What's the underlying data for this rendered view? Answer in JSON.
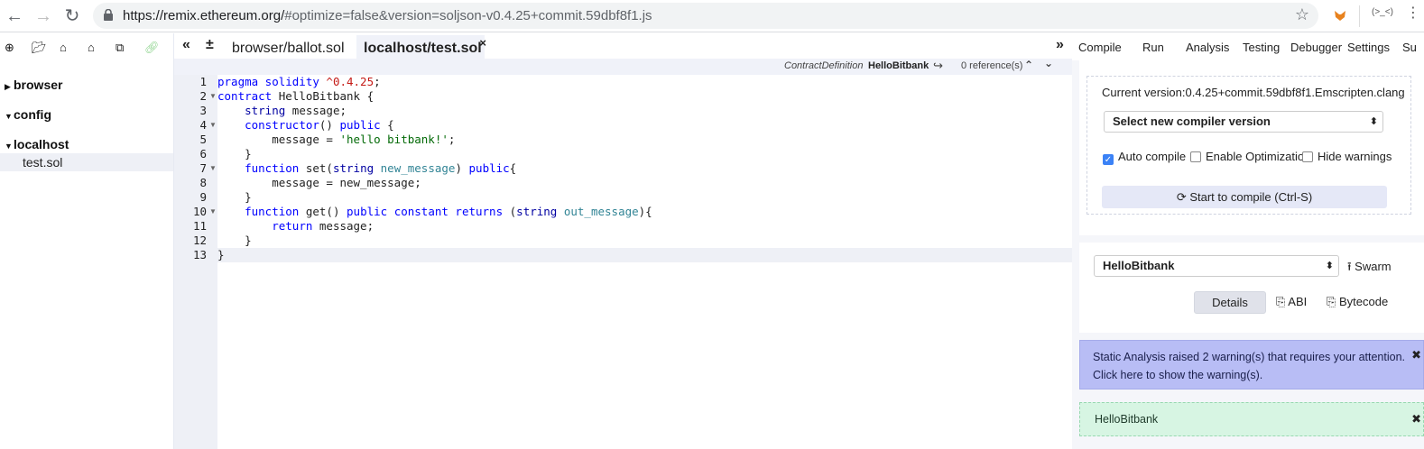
{
  "browser": {
    "url_host": "https://remix.ethereum.org/",
    "url_rest": "#optimize=false&version=soljson-v0.4.25+commit.59dbf8f1.js",
    "extension_text": "(>_<)"
  },
  "file_panel": {
    "tree": [
      {
        "label": "browser",
        "expanded": false
      },
      {
        "label": "config",
        "expanded": true
      },
      {
        "label": "localhost",
        "expanded": true
      }
    ],
    "file": "test.sol"
  },
  "editor": {
    "tabs": [
      {
        "label": "browser/ballot.sol",
        "active": false
      },
      {
        "label": "localhost/test.sol",
        "active": true
      }
    ],
    "close_glyph": "×",
    "info": {
      "definition": "ContractDefinition",
      "name": "HelloBitbank",
      "references": "0 reference(s)"
    },
    "line_numbers": [
      "1",
      "2",
      "3",
      "4",
      "5",
      "6",
      "7",
      "8",
      "9",
      "10",
      "11",
      "12",
      "13"
    ]
  },
  "right_panel": {
    "tabs": [
      "Compile",
      "Run",
      "Analysis",
      "Testing",
      "Debugger",
      "Settings",
      "Su"
    ],
    "current_version": "Current version:0.4.25+commit.59dbf8f1.Emscripten.clang",
    "compiler_select": "Select new compiler version",
    "checkboxes": [
      {
        "label": "Auto compile",
        "checked": true
      },
      {
        "label": "Enable Optimization",
        "checked": false
      },
      {
        "label": "Hide warnings",
        "checked": false
      }
    ],
    "compile_button": "Start to compile (Ctrl-S)",
    "contract_select": "HelloBitbank",
    "swarm": "Swarm",
    "details": "Details",
    "abi": "ABI",
    "bytecode": "Bytecode",
    "warning_line1": "Static Analysis raised 2 warning(s) that requires your attention.",
    "warning_line2": "Click here to show the warning(s).",
    "success": "HelloBitbank",
    "colors": {
      "warning_bg": "#b8bdf5",
      "success_bg": "#d7f5e3",
      "keyword": "#0000ff",
      "string": "#036a07"
    }
  }
}
